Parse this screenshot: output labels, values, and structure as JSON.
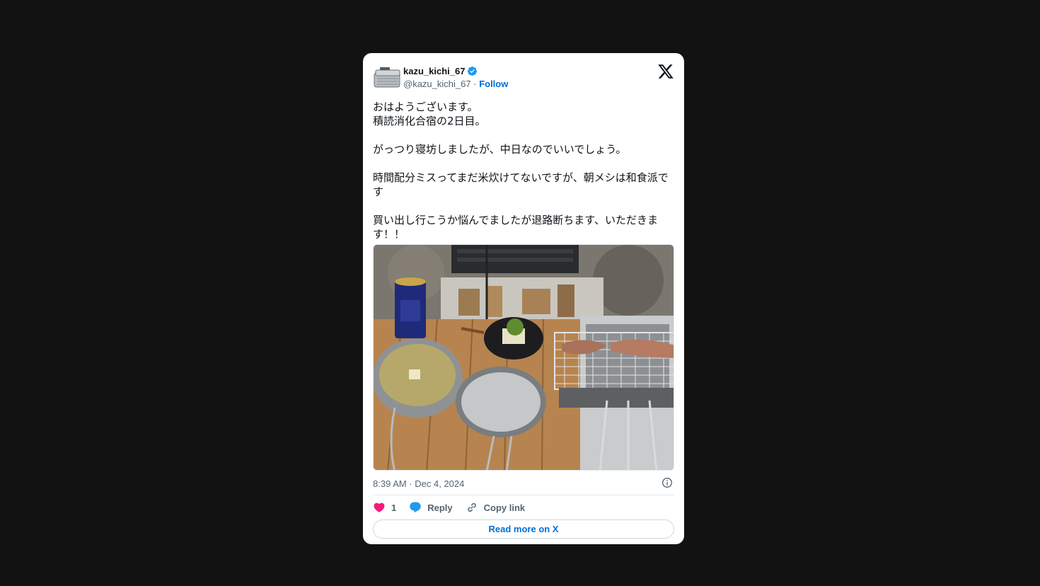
{
  "tweet": {
    "user": {
      "display_name": "kazu_kichi_67",
      "handle": "@kazu_kichi_67",
      "separator": "·",
      "follow_label": "Follow",
      "verified": true
    },
    "text": "おはようございます。\n積読消化合宿の2日目。\n\nがっつり寝坊しましたが、中日なのでいいでしょう。\n\n時間配分ミスってまだ米炊けてないですが、朝メシは和食派です\n\n買い出し行こうか悩んでましたが退路断ちます、いただきます！！",
    "timestamp": "8:39 AM · Dec 4, 2024",
    "actions": {
      "like_count": "1",
      "reply_label": "Reply",
      "copy_link_label": "Copy link"
    },
    "read_more_label": "Read more on X"
  },
  "colors": {
    "background": "#121212",
    "card": "#ffffff",
    "link_blue": "#006fd6",
    "verified_blue": "#1d9bf0",
    "like_pink": "#f91880",
    "muted_text": "#536471"
  },
  "icons": {
    "avatar": "mess-tin-avatar",
    "verified": "verified-badge-icon",
    "brand": "x-logo-icon",
    "info": "info-icon",
    "like": "heart-icon",
    "reply": "speech-bubble-icon",
    "copy_link": "link-icon"
  }
}
